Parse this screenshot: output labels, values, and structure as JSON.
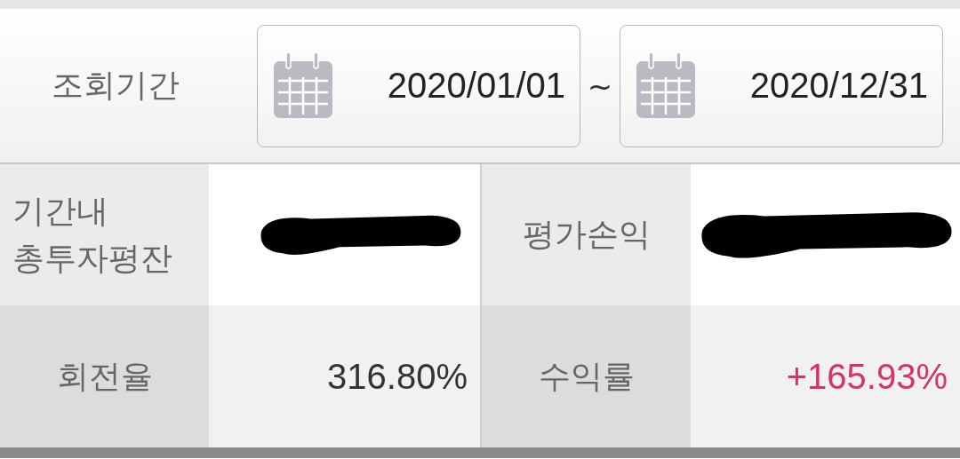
{
  "period": {
    "label": "조회기간",
    "start": "2020/01/01",
    "separator": "~",
    "end": "2020/12/31"
  },
  "stats": [
    {
      "label": "기간내\n총투자평잔",
      "kind": "redacted"
    },
    {
      "label": "평가손익",
      "kind": "redacted"
    },
    {
      "label": "회전율",
      "kind": "plain",
      "value": "316.80%"
    },
    {
      "label": "수익률",
      "kind": "rise",
      "value": "+165.93%"
    }
  ]
}
